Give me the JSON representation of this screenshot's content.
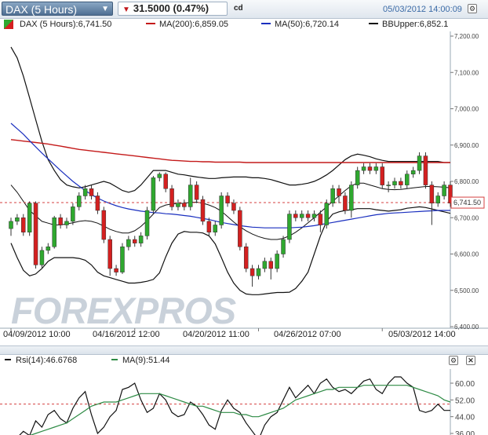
{
  "header": {
    "symbol": "DAX (5 Hours)",
    "change": "31.5000 (0.47%)",
    "cd": "cd",
    "datetime": "05/03/2012 14:00:09"
  },
  "legend": {
    "dax": "DAX (5 Hours):6,741.50",
    "ma200": "MA(200):6,859.05",
    "ma50": "MA(50):6,720.14",
    "bb": "BBUpper:6,852.1"
  },
  "rsi_legend": {
    "rsi": "Rsi(14):46.6768",
    "ma": "MA(9):51.44"
  },
  "watermark": "FOREXPROS",
  "colors": {
    "up": "#2fa82f",
    "down": "#d42020",
    "ma200": "#c41a1a",
    "ma50": "#1a2fbf",
    "bb": "#111111",
    "rsi": "#111111",
    "rsi_ma": "#2e8b45",
    "price_line": "#d44040"
  },
  "chart_data": [
    {
      "type": "candlestick",
      "title": "DAX (5 Hours)",
      "ylim": [
        6400,
        7200
      ],
      "yticks": [
        "7,200.00",
        "7,100.00",
        "7,000.00",
        "6,900.00",
        "6,800.00",
        "6,700.00",
        "6,600.00",
        "6,500.00",
        "6,400.00"
      ],
      "ytick_values": [
        7200,
        7100,
        7000,
        6900,
        6800,
        6700,
        6600,
        6500,
        6400
      ],
      "x_labels": [
        "04/09/2012 10:00",
        "04/16/2012 12:00",
        "04/20/2012 11:00",
        "04/26/2012 07:00",
        "05/03/2012 14:00"
      ],
      "x_label_index": [
        0,
        20,
        40,
        60,
        82
      ],
      "last_price": 6741.5,
      "last_price_label": "6,741.50",
      "candles": [
        [
          6670,
          6690,
          6650,
          6700
        ],
        [
          6690,
          6700,
          6680,
          6710
        ],
        [
          6700,
          6660,
          6650,
          6710
        ],
        [
          6660,
          6740,
          6650,
          6745
        ],
        [
          6740,
          6570,
          6560,
          6745
        ],
        [
          6570,
          6610,
          6560,
          6620
        ],
        [
          6610,
          6620,
          6600,
          6630
        ],
        [
          6620,
          6700,
          6615,
          6705
        ],
        [
          6700,
          6680,
          6670,
          6710
        ],
        [
          6680,
          6690,
          6670,
          6700
        ],
        [
          6690,
          6730,
          6680,
          6740
        ],
        [
          6730,
          6760,
          6720,
          6770
        ],
        [
          6760,
          6780,
          6750,
          6790
        ],
        [
          6780,
          6760,
          6750,
          6790
        ],
        [
          6760,
          6720,
          6710,
          6770
        ],
        [
          6720,
          6640,
          6630,
          6730
        ],
        [
          6640,
          6560,
          6540,
          6650
        ],
        [
          6560,
          6550,
          6540,
          6570
        ],
        [
          6550,
          6620,
          6545,
          6630
        ],
        [
          6620,
          6640,
          6610,
          6650
        ],
        [
          6640,
          6630,
          6620,
          6650
        ],
        [
          6630,
          6650,
          6620,
          6660
        ],
        [
          6650,
          6720,
          6640,
          6730
        ],
        [
          6720,
          6810,
          6710,
          6815
        ],
        [
          6810,
          6820,
          6800,
          6825
        ],
        [
          6820,
          6780,
          6770,
          6825
        ],
        [
          6780,
          6730,
          6720,
          6790
        ],
        [
          6730,
          6740,
          6720,
          6750
        ],
        [
          6740,
          6730,
          6720,
          6750
        ],
        [
          6730,
          6790,
          6720,
          6810
        ],
        [
          6790,
          6750,
          6740,
          6800
        ],
        [
          6750,
          6690,
          6680,
          6760
        ],
        [
          6690,
          6660,
          6650,
          6700
        ],
        [
          6660,
          6680,
          6650,
          6690
        ],
        [
          6680,
          6760,
          6670,
          6770
        ],
        [
          6760,
          6740,
          6730,
          6770
        ],
        [
          6740,
          6720,
          6710,
          6750
        ],
        [
          6720,
          6620,
          6610,
          6730
        ],
        [
          6620,
          6560,
          6550,
          6630
        ],
        [
          6560,
          6540,
          6510,
          6570
        ],
        [
          6540,
          6560,
          6530,
          6570
        ],
        [
          6560,
          6580,
          6550,
          6590
        ],
        [
          6580,
          6560,
          6530,
          6590
        ],
        [
          6560,
          6600,
          6550,
          6610
        ],
        [
          6600,
          6640,
          6590,
          6650
        ],
        [
          6640,
          6710,
          6630,
          6720
        ],
        [
          6710,
          6700,
          6690,
          6720
        ],
        [
          6700,
          6710,
          6690,
          6720
        ],
        [
          6710,
          6700,
          6690,
          6720
        ],
        [
          6700,
          6710,
          6690,
          6720
        ],
        [
          6710,
          6680,
          6660,
          6720
        ],
        [
          6680,
          6740,
          6670,
          6750
        ],
        [
          6740,
          6780,
          6730,
          6790
        ],
        [
          6780,
          6760,
          6740,
          6790
        ],
        [
          6760,
          6720,
          6710,
          6770
        ],
        [
          6720,
          6790,
          6700,
          6800
        ],
        [
          6790,
          6830,
          6780,
          6840
        ],
        [
          6830,
          6840,
          6820,
          6850
        ],
        [
          6840,
          6830,
          6820,
          6850
        ],
        [
          6830,
          6840,
          6820,
          6850
        ],
        [
          6840,
          6790,
          6780,
          6850
        ],
        [
          6790,
          6790,
          6770,
          6800
        ],
        [
          6790,
          6800,
          6780,
          6810
        ],
        [
          6800,
          6790,
          6780,
          6810
        ],
        [
          6790,
          6820,
          6780,
          6830
        ],
        [
          6820,
          6830,
          6810,
          6840
        ],
        [
          6830,
          6870,
          6820,
          6880
        ],
        [
          6870,
          6790,
          6780,
          6880
        ],
        [
          6790,
          6740,
          6680,
          6800
        ],
        [
          6740,
          6760,
          6730,
          6770
        ],
        [
          6760,
          6790,
          6750,
          6800
        ],
        [
          6790,
          6740,
          6730,
          6800
        ]
      ],
      "ma200": [
        6915,
        6913,
        6911,
        6909,
        6907,
        6905,
        6903,
        6900,
        6897,
        6894,
        6891,
        6888,
        6886,
        6884,
        6882,
        6880,
        6878,
        6876,
        6874,
        6872,
        6870,
        6868,
        6866,
        6864,
        6862,
        6860,
        6858,
        6857,
        6856,
        6855,
        6855,
        6854,
        6854,
        6853,
        6853,
        6853,
        6853,
        6853,
        6852,
        6852,
        6852,
        6852,
        6852,
        6852,
        6852,
        6852,
        6852,
        6852,
        6852,
        6852,
        6852,
        6852,
        6852,
        6852,
        6852,
        6852,
        6852,
        6852,
        6852,
        6852,
        6852,
        6852,
        6852,
        6852,
        6852,
        6852,
        6852,
        6852,
        6852,
        6852,
        6852,
        6852
      ],
      "ma50": [
        6960,
        6945,
        6930,
        6912,
        6895,
        6878,
        6862,
        6846,
        6830,
        6815,
        6800,
        6787,
        6775,
        6764,
        6754,
        6746,
        6739,
        6733,
        6728,
        6724,
        6721,
        6718,
        6716,
        6714,
        6713,
        6711,
        6710,
        6708,
        6706,
        6704,
        6701,
        6698,
        6695,
        6691,
        6687,
        6684,
        6681,
        6678,
        6676,
        6674,
        6673,
        6672,
        6672,
        6672,
        6672,
        6672,
        6673,
        6674,
        6676,
        6678,
        6681,
        6684,
        6687,
        6690,
        6693,
        6696,
        6699,
        6702,
        6705,
        6708,
        6710,
        6712,
        6713,
        6714,
        6715,
        6716,
        6717,
        6718,
        6719,
        6720,
        6720,
        6720
      ],
      "bb_upper": [
        7170,
        7140,
        7090,
        7030,
        6970,
        6910,
        6860,
        6830,
        6805,
        6790,
        6785,
        6782,
        6785,
        6790,
        6795,
        6800,
        6795,
        6785,
        6775,
        6770,
        6775,
        6790,
        6810,
        6830,
        6830,
        6830,
        6825,
        6820,
        6818,
        6815,
        6812,
        6810,
        6808,
        6808,
        6810,
        6811,
        6812,
        6812,
        6812,
        6810,
        6810,
        6808,
        6805,
        6800,
        6795,
        6790,
        6790,
        6792,
        6795,
        6800,
        6808,
        6818,
        6830,
        6845,
        6860,
        6870,
        6875,
        6872,
        6868,
        6862,
        6858,
        6855,
        6855,
        6855,
        6855,
        6855,
        6855,
        6855,
        6855,
        6855,
        6852,
        6852
      ],
      "bb_middle": [
        6790,
        6770,
        6745,
        6720,
        6705,
        6690,
        6685,
        6680,
        6680,
        6683,
        6686,
        6690,
        6692,
        6690,
        6685,
        6677,
        6668,
        6662,
        6658,
        6658,
        6664,
        6676,
        6692,
        6710,
        6728,
        6735,
        6738,
        6739,
        6740,
        6742,
        6743,
        6740,
        6735,
        6728,
        6718,
        6703,
        6688,
        6675,
        6664,
        6655,
        6648,
        6643,
        6640,
        6640,
        6643,
        6650,
        6660,
        6672,
        6686,
        6700,
        6715,
        6730,
        6745,
        6760,
        6775,
        6788,
        6795,
        6795,
        6790,
        6785,
        6780,
        6778,
        6777,
        6778,
        6780,
        6782,
        6784,
        6786,
        6786,
        6785,
        6784,
        6782
      ],
      "bb_lower": [
        6630,
        6590,
        6555,
        6540,
        6545,
        6560,
        6580,
        6590,
        6590,
        6590,
        6590,
        6588,
        6583,
        6570,
        6550,
        6540,
        6535,
        6530,
        6525,
        6520,
        6520,
        6522,
        6525,
        6530,
        6548,
        6592,
        6630,
        6655,
        6662,
        6660,
        6660,
        6658,
        6650,
        6628,
        6590,
        6550,
        6520,
        6500,
        6490,
        6488,
        6488,
        6490,
        6492,
        6494,
        6494,
        6495,
        6505,
        6525,
        6550,
        6600,
        6650,
        6690,
        6710,
        6716,
        6720,
        6722,
        6725,
        6725,
        6725,
        6722,
        6720,
        6718,
        6720,
        6722,
        6726,
        6728,
        6730,
        6728,
        6724,
        6720,
        6716,
        6712
      ]
    },
    {
      "type": "line",
      "title": "Rsi(14)",
      "ylim": [
        36,
        66
      ],
      "yticks": [
        "60.00",
        "52.00",
        "44.00",
        "36.00"
      ],
      "ytick_values": [
        60,
        52,
        44,
        36
      ],
      "reference_line": 50,
      "series": [
        {
          "name": "Rsi(14)",
          "values": [
            33,
            34,
            37,
            35,
            42,
            39,
            45,
            47,
            43,
            41,
            48,
            53,
            56,
            45,
            36,
            39,
            44,
            47,
            57,
            58,
            60,
            52,
            46,
            48,
            55,
            52,
            46,
            44,
            45,
            51,
            49,
            45,
            40,
            38,
            47,
            52,
            48,
            46,
            41,
            37,
            33,
            40,
            44,
            46,
            52,
            58,
            53,
            56,
            59,
            55,
            60,
            62,
            58,
            56,
            57,
            55,
            58,
            61,
            62,
            57,
            55,
            60,
            63,
            63,
            60,
            58,
            47,
            46,
            47,
            50,
            47,
            47
          ]
        },
        {
          "name": "MA(9)",
          "values": [
            32,
            33,
            34,
            35,
            36,
            37,
            38,
            39,
            40,
            41,
            43,
            45,
            47,
            49,
            50,
            51,
            51,
            51,
            52,
            53,
            54,
            55,
            55,
            55,
            55,
            54,
            53,
            52,
            51,
            50,
            49,
            49,
            48,
            47,
            46,
            46,
            46,
            45,
            45,
            44,
            44,
            45,
            46,
            47,
            48,
            50,
            52,
            53,
            54,
            55,
            56,
            57,
            57,
            58,
            58,
            58,
            58,
            59,
            59,
            59,
            59,
            59,
            59,
            59,
            59,
            58,
            57,
            56,
            55,
            54,
            52,
            51
          ]
        }
      ]
    }
  ]
}
